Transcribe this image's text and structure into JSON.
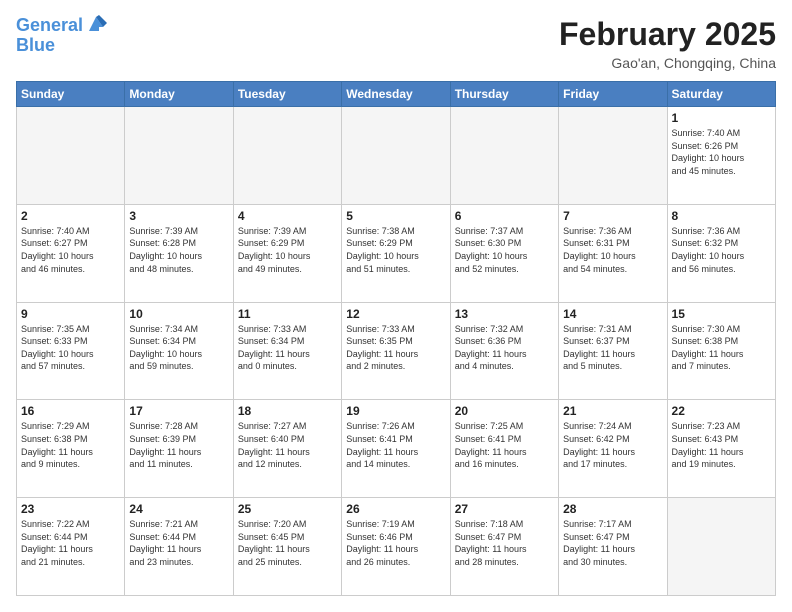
{
  "header": {
    "logo_line1": "General",
    "logo_line2": "Blue",
    "month_title": "February 2025",
    "subtitle": "Gao'an, Chongqing, China"
  },
  "weekdays": [
    "Sunday",
    "Monday",
    "Tuesday",
    "Wednesday",
    "Thursday",
    "Friday",
    "Saturday"
  ],
  "weeks": [
    [
      {
        "day": "",
        "info": ""
      },
      {
        "day": "",
        "info": ""
      },
      {
        "day": "",
        "info": ""
      },
      {
        "day": "",
        "info": ""
      },
      {
        "day": "",
        "info": ""
      },
      {
        "day": "",
        "info": ""
      },
      {
        "day": "1",
        "info": "Sunrise: 7:40 AM\nSunset: 6:26 PM\nDaylight: 10 hours\nand 45 minutes."
      }
    ],
    [
      {
        "day": "2",
        "info": "Sunrise: 7:40 AM\nSunset: 6:27 PM\nDaylight: 10 hours\nand 46 minutes."
      },
      {
        "day": "3",
        "info": "Sunrise: 7:39 AM\nSunset: 6:28 PM\nDaylight: 10 hours\nand 48 minutes."
      },
      {
        "day": "4",
        "info": "Sunrise: 7:39 AM\nSunset: 6:29 PM\nDaylight: 10 hours\nand 49 minutes."
      },
      {
        "day": "5",
        "info": "Sunrise: 7:38 AM\nSunset: 6:29 PM\nDaylight: 10 hours\nand 51 minutes."
      },
      {
        "day": "6",
        "info": "Sunrise: 7:37 AM\nSunset: 6:30 PM\nDaylight: 10 hours\nand 52 minutes."
      },
      {
        "day": "7",
        "info": "Sunrise: 7:36 AM\nSunset: 6:31 PM\nDaylight: 10 hours\nand 54 minutes."
      },
      {
        "day": "8",
        "info": "Sunrise: 7:36 AM\nSunset: 6:32 PM\nDaylight: 10 hours\nand 56 minutes."
      }
    ],
    [
      {
        "day": "9",
        "info": "Sunrise: 7:35 AM\nSunset: 6:33 PM\nDaylight: 10 hours\nand 57 minutes."
      },
      {
        "day": "10",
        "info": "Sunrise: 7:34 AM\nSunset: 6:34 PM\nDaylight: 10 hours\nand 59 minutes."
      },
      {
        "day": "11",
        "info": "Sunrise: 7:33 AM\nSunset: 6:34 PM\nDaylight: 11 hours\nand 0 minutes."
      },
      {
        "day": "12",
        "info": "Sunrise: 7:33 AM\nSunset: 6:35 PM\nDaylight: 11 hours\nand 2 minutes."
      },
      {
        "day": "13",
        "info": "Sunrise: 7:32 AM\nSunset: 6:36 PM\nDaylight: 11 hours\nand 4 minutes."
      },
      {
        "day": "14",
        "info": "Sunrise: 7:31 AM\nSunset: 6:37 PM\nDaylight: 11 hours\nand 5 minutes."
      },
      {
        "day": "15",
        "info": "Sunrise: 7:30 AM\nSunset: 6:38 PM\nDaylight: 11 hours\nand 7 minutes."
      }
    ],
    [
      {
        "day": "16",
        "info": "Sunrise: 7:29 AM\nSunset: 6:38 PM\nDaylight: 11 hours\nand 9 minutes."
      },
      {
        "day": "17",
        "info": "Sunrise: 7:28 AM\nSunset: 6:39 PM\nDaylight: 11 hours\nand 11 minutes."
      },
      {
        "day": "18",
        "info": "Sunrise: 7:27 AM\nSunset: 6:40 PM\nDaylight: 11 hours\nand 12 minutes."
      },
      {
        "day": "19",
        "info": "Sunrise: 7:26 AM\nSunset: 6:41 PM\nDaylight: 11 hours\nand 14 minutes."
      },
      {
        "day": "20",
        "info": "Sunrise: 7:25 AM\nSunset: 6:41 PM\nDaylight: 11 hours\nand 16 minutes."
      },
      {
        "day": "21",
        "info": "Sunrise: 7:24 AM\nSunset: 6:42 PM\nDaylight: 11 hours\nand 17 minutes."
      },
      {
        "day": "22",
        "info": "Sunrise: 7:23 AM\nSunset: 6:43 PM\nDaylight: 11 hours\nand 19 minutes."
      }
    ],
    [
      {
        "day": "23",
        "info": "Sunrise: 7:22 AM\nSunset: 6:44 PM\nDaylight: 11 hours\nand 21 minutes."
      },
      {
        "day": "24",
        "info": "Sunrise: 7:21 AM\nSunset: 6:44 PM\nDaylight: 11 hours\nand 23 minutes."
      },
      {
        "day": "25",
        "info": "Sunrise: 7:20 AM\nSunset: 6:45 PM\nDaylight: 11 hours\nand 25 minutes."
      },
      {
        "day": "26",
        "info": "Sunrise: 7:19 AM\nSunset: 6:46 PM\nDaylight: 11 hours\nand 26 minutes."
      },
      {
        "day": "27",
        "info": "Sunrise: 7:18 AM\nSunset: 6:47 PM\nDaylight: 11 hours\nand 28 minutes."
      },
      {
        "day": "28",
        "info": "Sunrise: 7:17 AM\nSunset: 6:47 PM\nDaylight: 11 hours\nand 30 minutes."
      },
      {
        "day": "",
        "info": ""
      }
    ]
  ]
}
